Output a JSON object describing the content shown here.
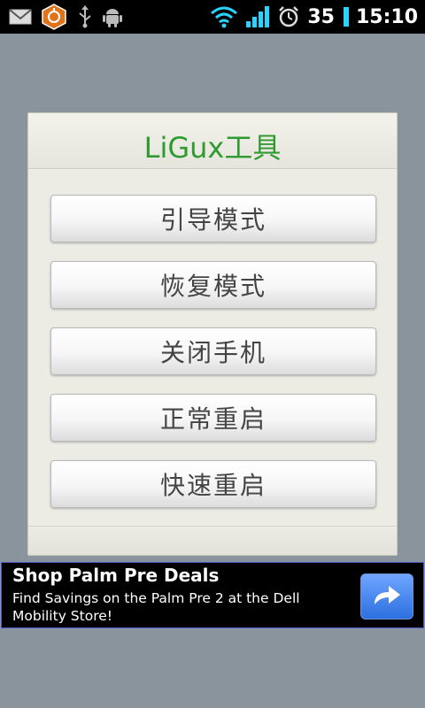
{
  "status_bar": {
    "battery_level": "35",
    "time": "15:10",
    "icons": [
      "gmail-icon",
      "app-notification-icon",
      "usb-icon",
      "android-debug-icon",
      "wifi-icon",
      "signal-icon",
      "alarm-icon",
      "battery-icon"
    ],
    "battery_color": "#2ad4ff"
  },
  "dialog": {
    "title": "LiGux工具",
    "title_color": "#2f9a2f",
    "buttons": [
      {
        "label": "引导模式"
      },
      {
        "label": "恢复模式"
      },
      {
        "label": "关闭手机"
      },
      {
        "label": "正常重启"
      },
      {
        "label": "快速重启"
      }
    ]
  },
  "ad": {
    "title": "Shop Palm Pre Deals",
    "text": "Find Savings on the Palm Pre 2 at the Dell Mobility Store!",
    "go_icon": "arrow-right-icon",
    "border_color": "#4a5cc9"
  }
}
